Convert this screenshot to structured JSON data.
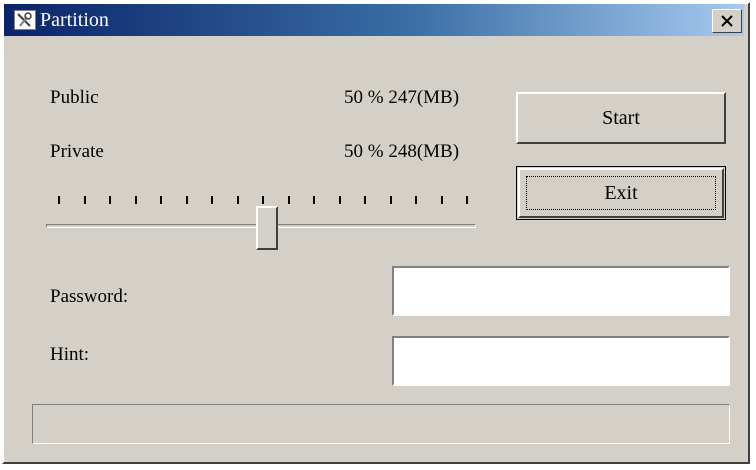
{
  "window": {
    "title": "Partition",
    "icon": "tools-icon",
    "close_glyph": "✕"
  },
  "partition": {
    "public": {
      "label": "Public",
      "value": "50 % 247(MB)"
    },
    "private": {
      "label": "Private",
      "value": "50 % 248(MB)"
    }
  },
  "slider": {
    "ticks": 17,
    "position_percent": 50
  },
  "buttons": {
    "start": "Start",
    "exit": "Exit"
  },
  "fields": {
    "password": {
      "label": "Password:",
      "value": ""
    },
    "hint": {
      "label": "Hint:",
      "value": ""
    }
  },
  "progress": {
    "percent": 0
  },
  "colors": {
    "face": "#d4d0c8",
    "title_start": "#0a246a",
    "title_end": "#a6caf0"
  }
}
